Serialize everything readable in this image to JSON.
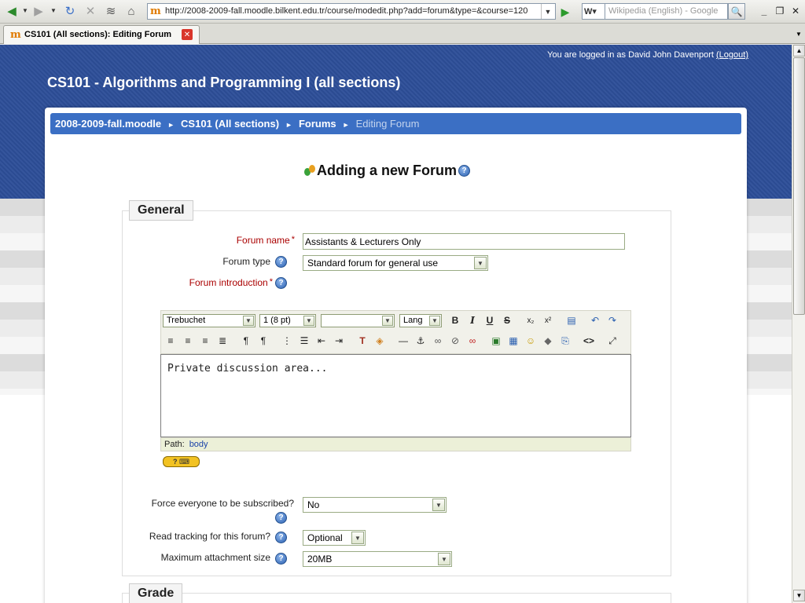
{
  "browser": {
    "url": "http://2008-2009-fall.moodle.bilkent.edu.tr/course/modedit.php?add=forum&type=&course=120",
    "search_placeholder": "Wikipedia (English) - Google",
    "search_engine_icon": "W",
    "tab_title": "CS101 (All sections): Editing Forum",
    "favicon": "m"
  },
  "header": {
    "login_text": "You are logged in as David John Davenport",
    "logout_label": "(Logout)",
    "site_title": "CS101 - Algorithms and Programming I (all sections)"
  },
  "breadcrumb": {
    "items": [
      "2008-2009-fall.moodle",
      "CS101 (All sections)",
      "Forums"
    ],
    "current": "Editing Forum",
    "separator": "►"
  },
  "page_title": "Adding a new Forum",
  "general": {
    "legend": "General",
    "forum_name_label": "Forum name",
    "forum_name_value": "Assistants & Lecturers Only",
    "forum_type_label": "Forum type",
    "forum_type_value": "Standard forum for general use",
    "intro_label": "Forum introduction",
    "required_mark": "*",
    "help_glyph": "?",
    "subscribe_label": "Force everyone to be subscribed?",
    "subscribe_value": "No",
    "tracking_label": "Read tracking for this forum?",
    "tracking_value": "Optional",
    "attachment_label": "Maximum attachment size",
    "attachment_value": "20MB"
  },
  "editor": {
    "font_family": "Trebuchet",
    "font_size": "1 (8 pt)",
    "heading": "",
    "lang": "Lang",
    "content": "Private discussion area...",
    "path_label": "Path:",
    "path_value": "body"
  },
  "grade": {
    "legend": "Grade"
  },
  "colors": {
    "header_blue": "#2d4e98",
    "breadcrumb_blue": "#3b6fc4",
    "required_red": "#aa0000"
  }
}
